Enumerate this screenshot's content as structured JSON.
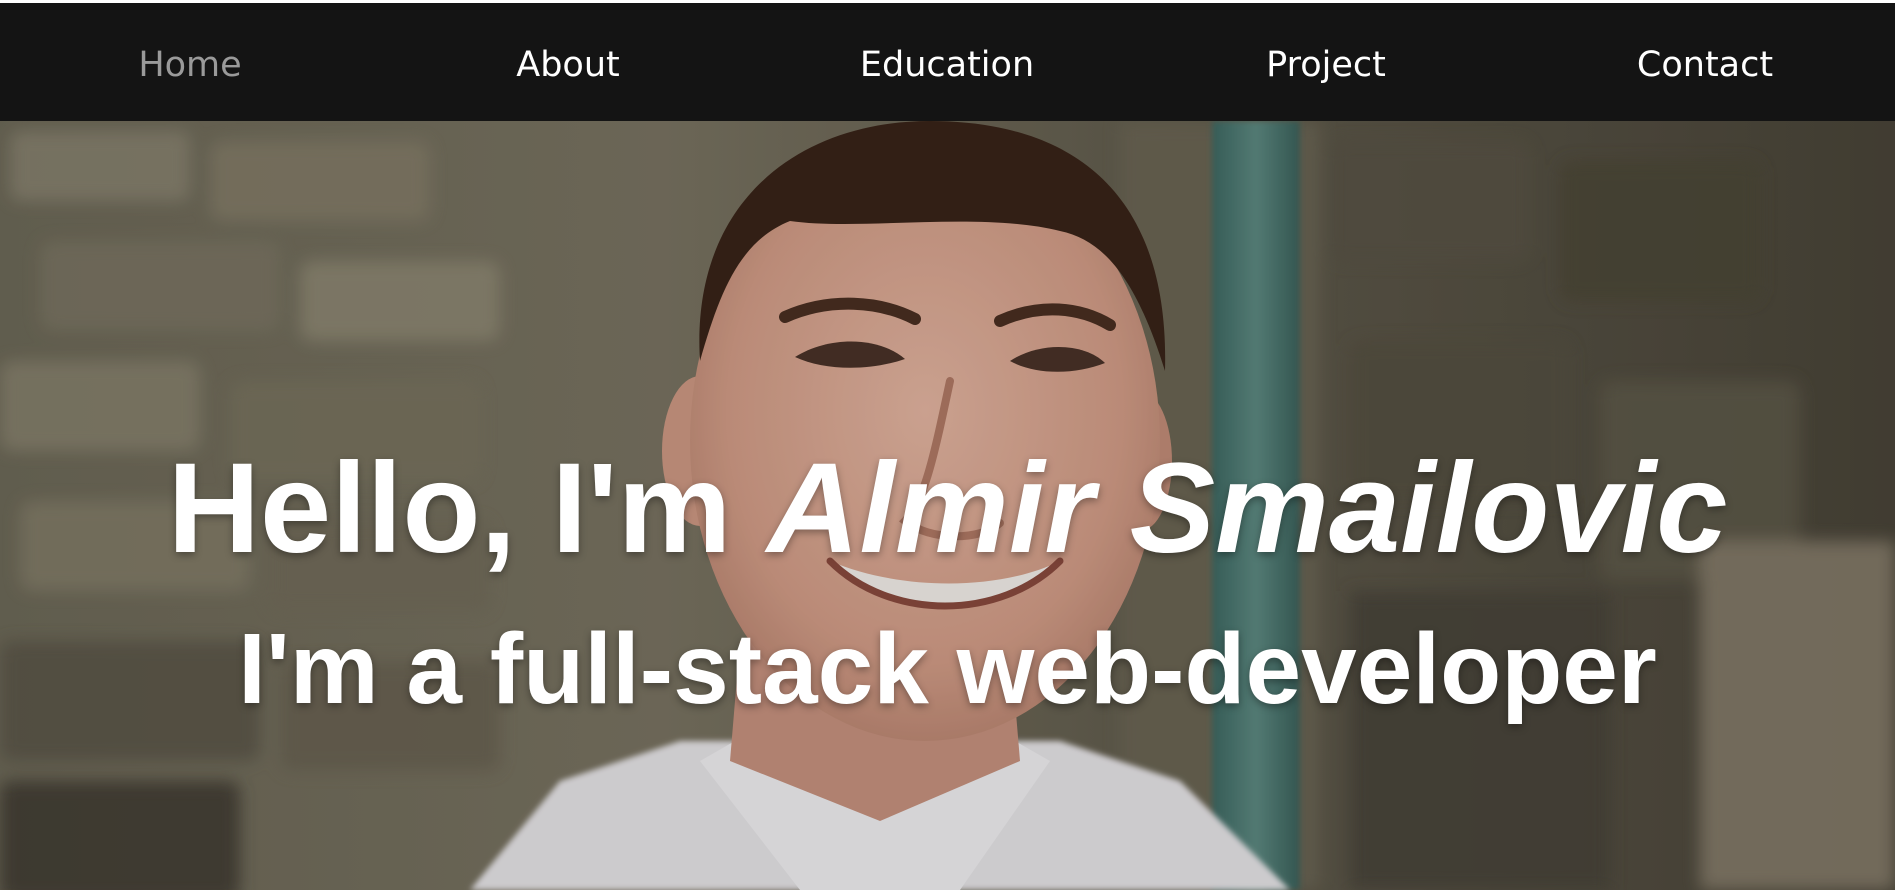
{
  "nav": {
    "items": [
      {
        "label": "Home",
        "active": true
      },
      {
        "label": "About",
        "active": false
      },
      {
        "label": "Education",
        "active": false
      },
      {
        "label": "Project",
        "active": false
      },
      {
        "label": "Contact",
        "active": false
      }
    ],
    "background": "#141414",
    "text_color": "#ffffff",
    "active_color": "#9a9a9a"
  },
  "hero": {
    "greeting": "Hello, I'm",
    "name": "Almir Smailovic",
    "tagline": "I'm a full-stack web-developer",
    "image_icon": "portrait-photo",
    "text_color": "#ffffff"
  }
}
